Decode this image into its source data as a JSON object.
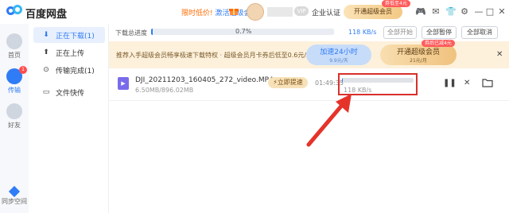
{
  "app": {
    "title": "百度网盘"
  },
  "topbar": {
    "promo_text": "限时低价!",
    "promo_action": "激活超级会员",
    "vip_badge": "VIP",
    "enterprise": "企业认证",
    "open_vip": "开通超级会员",
    "discount_tag": "券低至4元",
    "icons": [
      "gift-icon",
      "game-icon",
      "mail-icon",
      "shirt-icon",
      "gear-icon",
      "minimize-icon",
      "maximize-icon",
      "close-icon"
    ]
  },
  "sidebar": {
    "items": [
      {
        "label": "首页",
        "icon": "home-icon"
      },
      {
        "label": "传输",
        "icon": "transfer-icon",
        "badge": "1"
      },
      {
        "label": "好友",
        "icon": "friends-icon"
      },
      {
        "label": "同步空间",
        "icon": "sync-icon"
      }
    ]
  },
  "nav": {
    "items": [
      {
        "label": "正在下载(1)",
        "icon": "download-icon",
        "active": true
      },
      {
        "label": "正在上传",
        "icon": "upload-icon"
      },
      {
        "label": "传输完成(1)",
        "icon": "done-icon"
      },
      {
        "label": "文件快传",
        "icon": "quick-transfer-icon"
      }
    ]
  },
  "summary": {
    "label": "下载总进度",
    "percent_text": "0.7%",
    "progress": 0.007,
    "speed": "118 KB/s",
    "btn_start_all": "全部开始",
    "btn_pause_all": "全部暂停",
    "btn_cancel_all": "全部取消"
  },
  "banner": {
    "text": "推荐入手超级会员畅享极速下载特权 · 超级会员月卡券后低至0.6元/天起",
    "trial_main": "加速24小时",
    "trial_sub": "9.9元/天",
    "vip_main": "开通超级会员",
    "vip_sub": "21元/月",
    "vip_tag": "券后已减4元",
    "close_icon": "close-icon"
  },
  "task": {
    "file_type": "video-file-icon",
    "file_name": "DJI_20211203_160405_272_video.MP4",
    "size": "6.50MB/896.02MB",
    "speedup": "⚡立即提速",
    "time_left": "01:49:35",
    "progress": 0.007,
    "speed": "118 KB/s",
    "actions": [
      "pause-icon",
      "cancel-icon",
      "folder-icon"
    ]
  },
  "colors": {
    "accent": "#2f7cf6",
    "highlight": "#d9302b"
  }
}
